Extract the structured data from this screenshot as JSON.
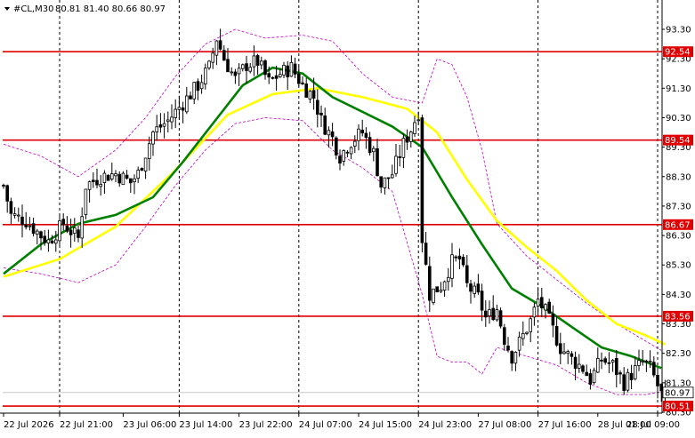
{
  "header": {
    "symbol": "#CL,M30",
    "ohlc": "80.81 81.40 80.66 80.97"
  },
  "colors": {
    "background": "#ffffff",
    "bull_candle": "#ffffff",
    "bear_candle": "#000000",
    "candle_outline": "#000000",
    "level_line": "#e00000",
    "level_label_bg": "#e00000",
    "level_label_text": "#ffffff",
    "ma_fast": "#008000",
    "ma_slow": "#ffff00",
    "envelope": "#c000c0",
    "grid_vertical": "#000000",
    "last_price_bg": "#ffffff",
    "last_price_line": "#c8c8c8"
  },
  "chart_data": {
    "type": "candlestick",
    "title": "#CL,M30",
    "symbol": "#CL",
    "timeframe": "M30",
    "last_bar": {
      "open": 80.81,
      "high": 81.4,
      "low": 80.66,
      "close": 80.97
    },
    "last_price": 80.97,
    "ylim": [
      80.3,
      94.0
    ],
    "y_ticks": [
      93.3,
      92.3,
      91.3,
      90.3,
      89.3,
      88.3,
      87.3,
      86.3,
      85.3,
      84.3,
      83.3,
      82.3,
      81.3,
      80.3
    ],
    "y_tick_labels": [
      "93.30",
      "92.30",
      "91.30",
      "90.30",
      "89.30",
      "88.30",
      "87.30",
      "86.30",
      "85.30",
      "84.30",
      "83.30",
      "82.30",
      "81.30",
      "80.30"
    ],
    "x_tick_labels": [
      "22 Jul 2026",
      "22 Jul 21:00",
      "23 Jul 06:00",
      "23 Jul 14:00",
      "23 Jul 22:00",
      "24 Jul 07:00",
      "24 Jul 15:00",
      "24 Jul 23:00",
      "27 Jul 08:00",
      "27 Jul 16:00",
      "28 Jul 01:00",
      "28 Jul 09:00"
    ],
    "x_tick_bar_index": [
      0,
      15,
      32,
      47,
      63,
      79,
      95,
      111,
      127,
      143,
      159,
      175
    ],
    "vertical_grid_bar_index": [
      15,
      47,
      79,
      111,
      143,
      175
    ],
    "horizontal_levels": [
      {
        "value": 92.54,
        "label": "92.54"
      },
      {
        "value": 89.54,
        "label": "89.54"
      },
      {
        "value": 86.67,
        "label": "86.67"
      },
      {
        "value": 83.56,
        "label": "83.56"
      },
      {
        "value": 80.51,
        "label": "80.51"
      }
    ],
    "bar_count": 178,
    "close_path": [
      [
        0,
        88.0
      ],
      [
        2,
        87.0
      ],
      [
        6,
        86.8
      ],
      [
        10,
        86.3
      ],
      [
        12,
        86.1
      ],
      [
        16,
        86.7
      ],
      [
        20,
        86.2
      ],
      [
        22,
        88.0
      ],
      [
        26,
        88.3
      ],
      [
        30,
        88.4
      ],
      [
        34,
        88.1
      ],
      [
        36,
        88.4
      ],
      [
        40,
        89.8
      ],
      [
        44,
        90.2
      ],
      [
        48,
        90.8
      ],
      [
        52,
        91.4
      ],
      [
        55,
        92.0
      ],
      [
        57,
        93.0
      ],
      [
        59,
        92.3
      ],
      [
        62,
        91.6
      ],
      [
        65,
        92.1
      ],
      [
        68,
        92.2
      ],
      [
        71,
        91.5
      ],
      [
        74,
        91.8
      ],
      [
        77,
        92.0
      ],
      [
        80,
        91.4
      ],
      [
        83,
        91.0
      ],
      [
        85,
        90.2
      ],
      [
        88,
        89.6
      ],
      [
        90,
        89.0
      ],
      [
        93,
        89.5
      ],
      [
        96,
        89.8
      ],
      [
        99,
        89.1
      ],
      [
        101,
        88.0
      ],
      [
        104,
        88.4
      ],
      [
        107,
        89.4
      ],
      [
        109,
        89.9
      ],
      [
        111,
        90.5
      ],
      [
        112,
        86.2
      ],
      [
        114,
        84.3
      ],
      [
        117,
        84.6
      ],
      [
        120,
        85.4
      ],
      [
        122,
        85.5
      ],
      [
        124,
        84.6
      ],
      [
        127,
        84.2
      ],
      [
        129,
        83.5
      ],
      [
        132,
        83.8
      ],
      [
        134,
        82.8
      ],
      [
        136,
        82.2
      ],
      [
        139,
        82.9
      ],
      [
        141,
        83.4
      ],
      [
        143,
        84.1
      ],
      [
        145,
        83.7
      ],
      [
        147,
        83.1
      ],
      [
        149,
        82.5
      ],
      [
        152,
        82.1
      ],
      [
        155,
        81.8
      ],
      [
        157,
        81.4
      ],
      [
        160,
        82.1
      ],
      [
        163,
        81.9
      ],
      [
        166,
        81.3
      ],
      [
        168,
        81.6
      ],
      [
        171,
        82.0
      ],
      [
        173,
        81.8
      ],
      [
        175,
        81.2
      ],
      [
        176,
        80.9
      ],
      [
        177,
        80.97
      ]
    ],
    "ma_fast_path": [
      [
        0,
        85.0
      ],
      [
        10,
        86.0
      ],
      [
        20,
        86.7
      ],
      [
        30,
        87.0
      ],
      [
        40,
        87.6
      ],
      [
        48,
        88.8
      ],
      [
        56,
        90.1
      ],
      [
        64,
        91.4
      ],
      [
        72,
        92.0
      ],
      [
        80,
        91.8
      ],
      [
        88,
        91.0
      ],
      [
        96,
        90.5
      ],
      [
        104,
        90.0
      ],
      [
        112,
        89.3
      ],
      [
        120,
        87.6
      ],
      [
        128,
        86.0
      ],
      [
        136,
        84.5
      ],
      [
        144,
        83.9
      ],
      [
        152,
        83.2
      ],
      [
        160,
        82.5
      ],
      [
        168,
        82.2
      ],
      [
        176,
        81.8
      ]
    ],
    "ma_slow_path": [
      [
        0,
        84.9
      ],
      [
        15,
        85.5
      ],
      [
        30,
        86.6
      ],
      [
        45,
        88.4
      ],
      [
        60,
        90.4
      ],
      [
        72,
        91.1
      ],
      [
        84,
        91.3
      ],
      [
        96,
        91.0
      ],
      [
        108,
        90.6
      ],
      [
        116,
        89.8
      ],
      [
        124,
        88.2
      ],
      [
        132,
        86.8
      ],
      [
        140,
        85.9
      ],
      [
        148,
        85.1
      ],
      [
        156,
        84.1
      ],
      [
        164,
        83.3
      ],
      [
        172,
        82.9
      ],
      [
        177,
        82.6
      ]
    ],
    "envelope_upper_path": [
      [
        0,
        89.4
      ],
      [
        10,
        89.0
      ],
      [
        20,
        88.3
      ],
      [
        30,
        89.2
      ],
      [
        38,
        90.3
      ],
      [
        46,
        91.7
      ],
      [
        54,
        92.8
      ],
      [
        62,
        93.3
      ],
      [
        70,
        93.0
      ],
      [
        80,
        93.1
      ],
      [
        88,
        92.9
      ],
      [
        96,
        91.8
      ],
      [
        104,
        91.0
      ],
      [
        112,
        90.8
      ],
      [
        116,
        92.3
      ],
      [
        120,
        92.1
      ],
      [
        124,
        91.0
      ],
      [
        128,
        89.2
      ],
      [
        132,
        86.7
      ],
      [
        140,
        85.6
      ],
      [
        148,
        84.8
      ],
      [
        156,
        84.0
      ],
      [
        164,
        83.3
      ],
      [
        172,
        82.7
      ],
      [
        176,
        82.4
      ]
    ],
    "envelope_lower_path": [
      [
        0,
        85.2
      ],
      [
        10,
        85.0
      ],
      [
        20,
        84.7
      ],
      [
        30,
        85.3
      ],
      [
        38,
        86.6
      ],
      [
        46,
        88.0
      ],
      [
        54,
        89.2
      ],
      [
        62,
        90.1
      ],
      [
        70,
        90.3
      ],
      [
        80,
        90.2
      ],
      [
        88,
        89.2
      ],
      [
        96,
        88.6
      ],
      [
        104,
        87.8
      ],
      [
        112,
        84.3
      ],
      [
        116,
        82.2
      ],
      [
        120,
        82.0
      ],
      [
        124,
        82.0
      ],
      [
        128,
        81.6
      ],
      [
        132,
        82.5
      ],
      [
        140,
        82.2
      ],
      [
        148,
        81.9
      ],
      [
        156,
        81.3
      ],
      [
        164,
        80.9
      ],
      [
        172,
        80.9
      ],
      [
        176,
        81.0
      ]
    ]
  }
}
